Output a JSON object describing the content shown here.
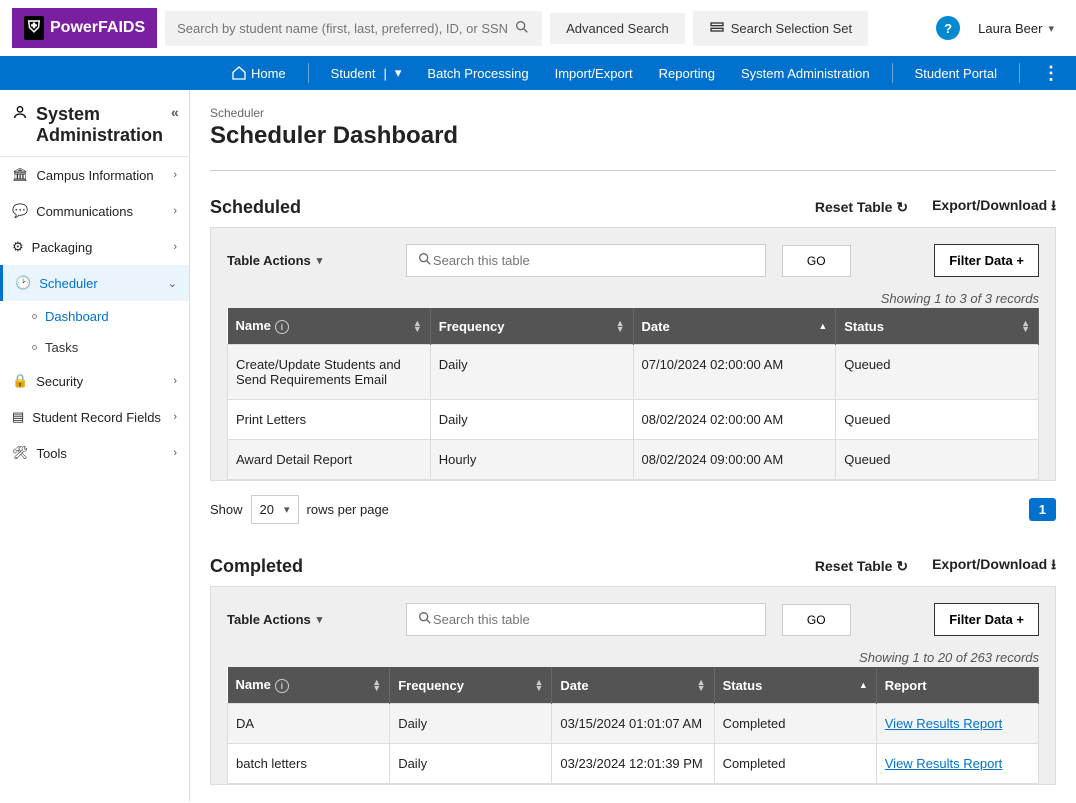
{
  "logo": {
    "text": "PowerFAIDS",
    "shield_glyph": "⛨"
  },
  "search": {
    "placeholder": "Search by student name (first, last, preferred), ID, or SSN"
  },
  "top_buttons": {
    "advanced": "Advanced Search",
    "selection": "Search Selection Set"
  },
  "help_glyph": "?",
  "user": {
    "name": "Laura Beer"
  },
  "nav": {
    "home": "Home",
    "student": "Student",
    "batch": "Batch Processing",
    "import": "Import/Export",
    "reporting": "Reporting",
    "sysadmin": "System Administration",
    "portal": "Student Portal"
  },
  "sidebar": {
    "title": "System Administration",
    "collapse_glyph": "«",
    "items": [
      {
        "label": "Campus Information"
      },
      {
        "label": "Communications"
      },
      {
        "label": "Packaging"
      },
      {
        "label": "Scheduler",
        "active": true
      },
      {
        "label": "Security"
      },
      {
        "label": "Student Record Fields"
      },
      {
        "label": "Tools"
      }
    ],
    "scheduler_sub": [
      {
        "label": "Dashboard",
        "active": true
      },
      {
        "label": "Tasks"
      }
    ]
  },
  "breadcrumb": "Scheduler",
  "page_title": "Scheduler Dashboard",
  "scheduled": {
    "title": "Scheduled",
    "reset": "Reset Table",
    "export": "Export/Download",
    "table_actions": "Table Actions",
    "search_placeholder": "Search this table",
    "go": "GO",
    "filter": "Filter Data",
    "records_info": "Showing 1 to 3 of 3 records",
    "columns": {
      "name": "Name",
      "frequency": "Frequency",
      "date": "Date",
      "status": "Status"
    },
    "rows": [
      {
        "name": "Create/Update Students and Send Requirements Email",
        "freq": "Daily",
        "date": "07/10/2024 02:00:00 AM",
        "status": "Queued"
      },
      {
        "name": "Print Letters",
        "freq": "Daily",
        "date": "08/02/2024 02:00:00 AM",
        "status": "Queued"
      },
      {
        "name": "Award Detail Report",
        "freq": "Hourly",
        "date": "08/02/2024 09:00:00 AM",
        "status": "Queued"
      }
    ],
    "pager": {
      "show": "Show",
      "size": "20",
      "rows_label": "rows per page",
      "page": "1"
    }
  },
  "completed": {
    "title": "Completed",
    "reset": "Reset Table",
    "export": "Export/Download",
    "table_actions": "Table Actions",
    "search_placeholder": "Search this table",
    "go": "GO",
    "filter": "Filter Data",
    "records_info": "Showing 1 to 20 of 263 records",
    "columns": {
      "name": "Name",
      "frequency": "Frequency",
      "date": "Date",
      "status": "Status",
      "report": "Report"
    },
    "rows": [
      {
        "name": "DA",
        "freq": "Daily",
        "date": "03/15/2024 01:01:07 AM",
        "status": "Completed",
        "report": "View Results Report"
      },
      {
        "name": "batch letters",
        "freq": "Daily",
        "date": "03/23/2024 12:01:39 PM",
        "status": "Completed",
        "report": "View Results Report"
      }
    ]
  }
}
